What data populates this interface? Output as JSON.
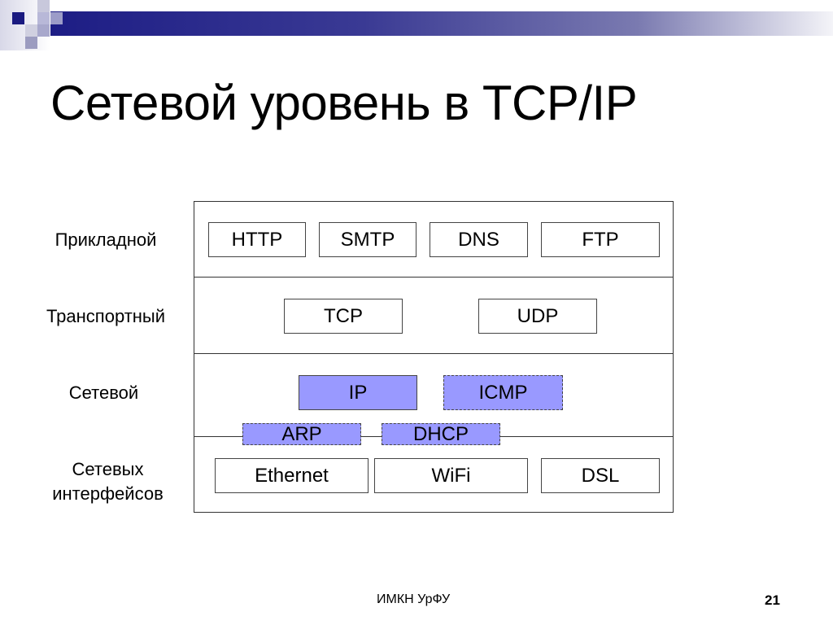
{
  "slide": {
    "title": "Сетевой уровень в TCP/IP",
    "footer_org": "ИМКН УрФУ",
    "page_number": "21",
    "accent_color": "#1d1d85",
    "protocol_highlight_color": "#9999ff"
  },
  "layers": [
    {
      "name": "Прикладной",
      "protocols": [
        "HTTP",
        "SMTP",
        "DNS",
        "FTP"
      ]
    },
    {
      "name": "Транспортный",
      "protocols": [
        "TCP",
        "UDP"
      ]
    },
    {
      "name": "Сетевой",
      "protocols": [
        "IP",
        "ICMP"
      ]
    },
    {
      "name_line1": "Сетевых",
      "name_line2": "интерфейсов",
      "protocols": [
        "Ethernet",
        "WiFi",
        "DSL"
      ]
    }
  ],
  "boundary_protocols": [
    "ARP",
    "DHCP"
  ]
}
